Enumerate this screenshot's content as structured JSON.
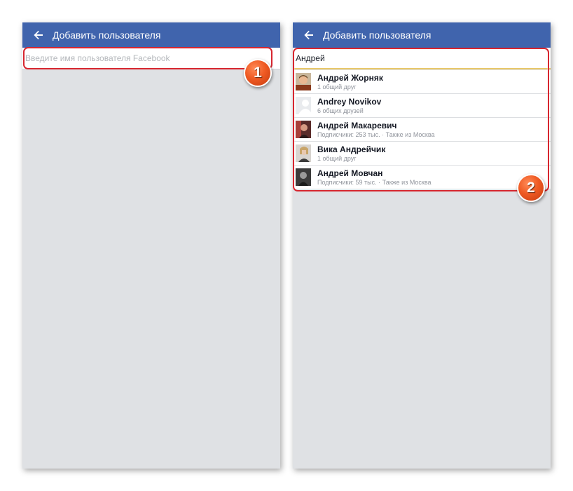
{
  "screens": {
    "left": {
      "title": "Добавить пользователя",
      "search": {
        "value": "",
        "placeholder": "Введите имя пользователя Facebook"
      }
    },
    "right": {
      "title": "Добавить пользователя",
      "search": {
        "value": "Андрей",
        "placeholder": "Введите имя пользователя Facebook"
      },
      "results": [
        {
          "name": "Андрей Жорняк",
          "subtitle": "1 общий друг",
          "avatar": "user-photo-icon"
        },
        {
          "name": "Andrey Novikov",
          "subtitle": "6 общих друзей",
          "avatar": "default-avatar-icon"
        },
        {
          "name": "Андрей Макаревич",
          "subtitle": "Подписчики: 253 тыс. · Также из Москва",
          "avatar": "user-photo-icon"
        },
        {
          "name": "Вика Андрейчик",
          "subtitle": "1 общий друг",
          "avatar": "user-photo-icon"
        },
        {
          "name": "Андрей Мовчан",
          "subtitle": "Подписчики: 59 тыс. · Также из Москва",
          "avatar": "user-photo-icon"
        }
      ]
    }
  },
  "callouts": {
    "first": "1",
    "second": "2"
  },
  "icons": {
    "back": "arrow-left-icon"
  },
  "colors": {
    "appbar": "#4064ad",
    "callout_frame": "#d7262f",
    "callout_badge": "#ef5a23",
    "input_underline": "#e8c769"
  }
}
